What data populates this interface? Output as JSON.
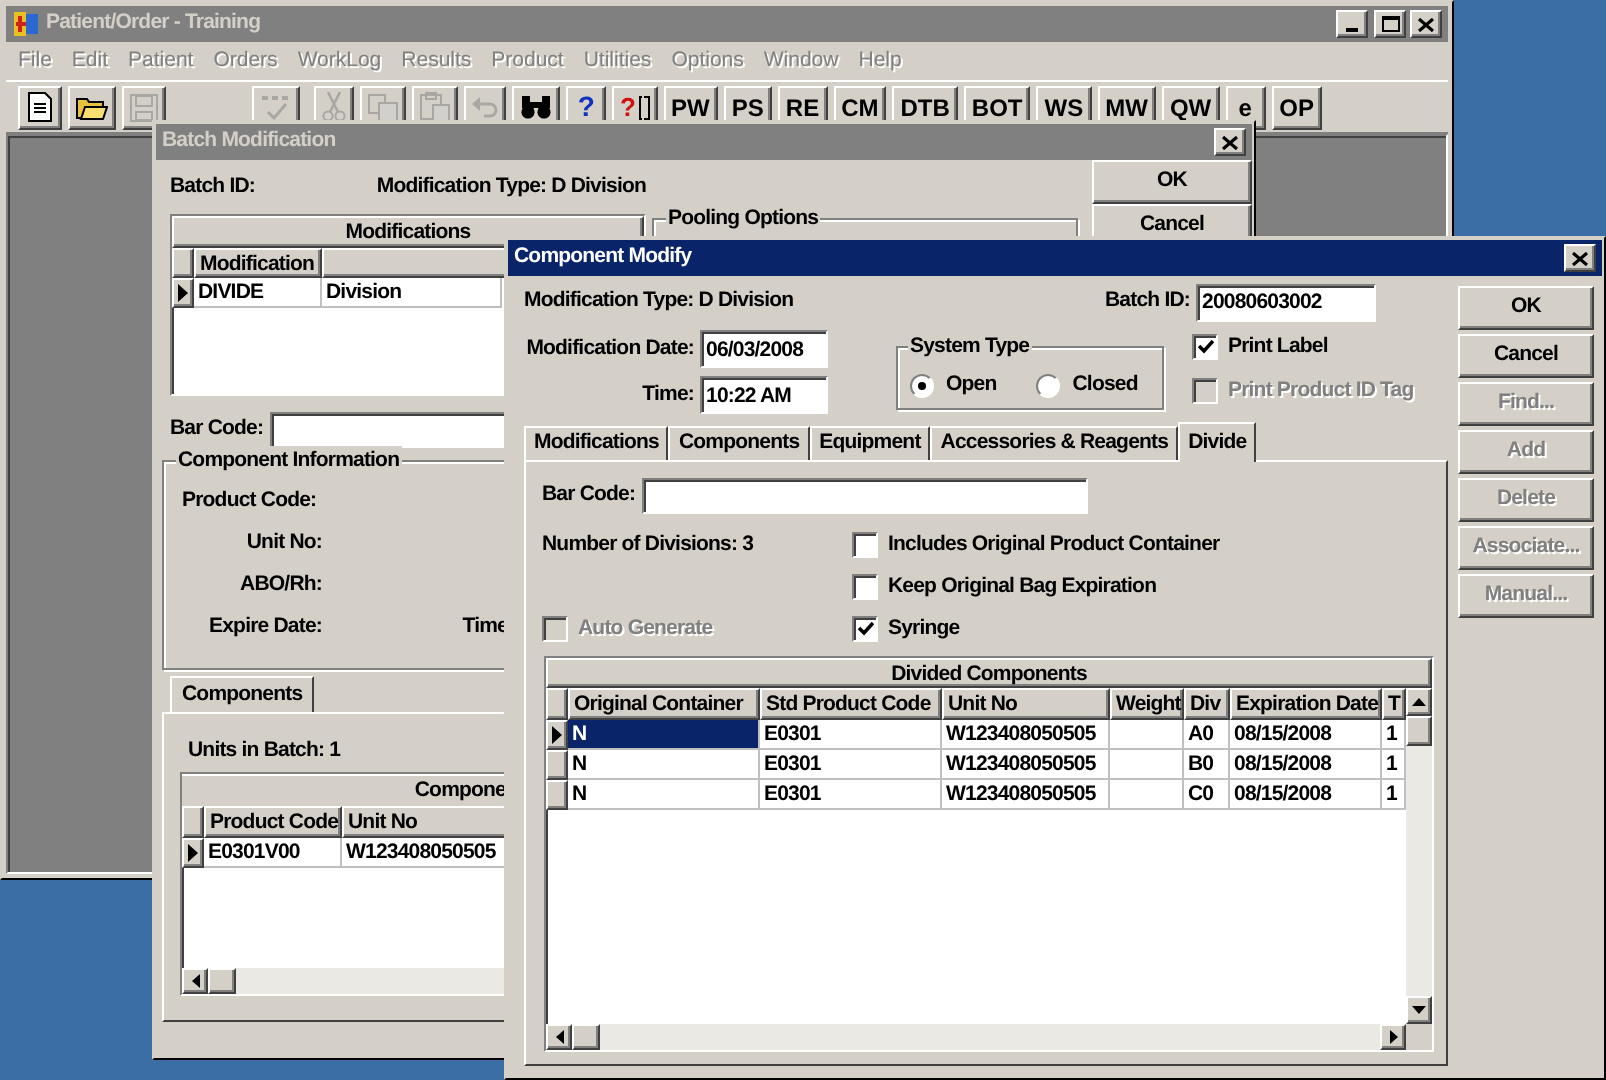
{
  "main_window": {
    "title": "Patient/Order - Training",
    "active": false,
    "menu": [
      {
        "label": "File",
        "disabled": true
      },
      {
        "label": "Edit",
        "disabled": true
      },
      {
        "label": "Patient",
        "disabled": true
      },
      {
        "label": "Orders",
        "disabled": true
      },
      {
        "label": "WorkLog",
        "disabled": true
      },
      {
        "label": "Results",
        "disabled": true
      },
      {
        "label": "Product",
        "disabled": true
      },
      {
        "label": "Utilities",
        "disabled": true
      },
      {
        "label": "Options",
        "disabled": true
      },
      {
        "label": "Window",
        "disabled": true
      },
      {
        "label": "Help",
        "disabled": true
      }
    ],
    "toolbar": [
      {
        "kind": "new",
        "disabled": false
      },
      {
        "kind": "open",
        "disabled": false
      },
      {
        "kind": "save",
        "disabled": true
      },
      {
        "kind": "spell",
        "disabled": true
      },
      {
        "kind": "cut",
        "disabled": true
      },
      {
        "kind": "copy",
        "disabled": true
      },
      {
        "kind": "paste",
        "disabled": true
      },
      {
        "kind": "undo",
        "disabled": true
      },
      {
        "kind": "find",
        "disabled": false
      },
      {
        "kind": "help",
        "label": "?"
      },
      {
        "kind": "context-help",
        "label": "?"
      },
      {
        "kind": "text",
        "label": "PW"
      },
      {
        "kind": "text",
        "label": "PS"
      },
      {
        "kind": "text",
        "label": "RE"
      },
      {
        "kind": "text",
        "label": "CM"
      },
      {
        "kind": "text",
        "label": "DTB"
      },
      {
        "kind": "text",
        "label": "BOT"
      },
      {
        "kind": "text",
        "label": "WS"
      },
      {
        "kind": "text",
        "label": "MW"
      },
      {
        "kind": "text",
        "label": "QW"
      },
      {
        "kind": "text",
        "label": "e"
      },
      {
        "kind": "text",
        "label": "OP"
      }
    ]
  },
  "batch_window": {
    "title": "Batch Modification",
    "active": false,
    "batch_id_label": "Batch ID:",
    "modification_type": "Modification Type: D  Division",
    "buttons": [
      {
        "label": "OK"
      },
      {
        "label": "Cancel"
      }
    ],
    "modifications": {
      "title": "Modifications",
      "columns": [
        "Modification"
      ],
      "rows": [
        {
          "cells": [
            "DIVIDE",
            "Division"
          ],
          "selected": true
        }
      ]
    },
    "pooling_options": "Pooling Options",
    "bar_code_label": "Bar Code:",
    "component_information": {
      "title": "Component Information",
      "fields": [
        "Product Code:",
        "Unit No:",
        "ABO/Rh:",
        "Expire Date:"
      ],
      "time_label": "Time"
    },
    "tabs": [
      {
        "label": "Components",
        "selected": true
      }
    ],
    "units_in_batch": "Units in Batch: 1",
    "components": {
      "title": "Compone",
      "columns": [
        "Product Code",
        "Unit No"
      ],
      "rows": [
        {
          "cells": [
            "E0301V00",
            "W123408050505"
          ],
          "selected": true
        }
      ]
    }
  },
  "component_window": {
    "title": "Component Modify",
    "active": true,
    "modification_type": "Modification Type: D  Division",
    "batch_id": {
      "label": "Batch ID:",
      "value": "20080603002"
    },
    "modification_date": {
      "label": "Modification Date:",
      "value": "06/03/2008"
    },
    "time": {
      "label": "Time:",
      "value": "10:22 AM"
    },
    "system_type": {
      "title": "System Type",
      "options": [
        {
          "label": "Open",
          "selected": true
        },
        {
          "label": "Closed",
          "selected": false
        }
      ]
    },
    "print_options": [
      {
        "label": "Print Label",
        "checked": true,
        "disabled": false
      },
      {
        "label": "Print Product ID Tag",
        "checked": false,
        "disabled": true
      }
    ],
    "buttons": [
      {
        "label": "OK",
        "disabled": false
      },
      {
        "label": "Cancel",
        "disabled": false
      },
      {
        "label": "Find...",
        "disabled": true
      },
      {
        "label": "Add",
        "disabled": true
      },
      {
        "label": "Delete",
        "disabled": true
      },
      {
        "label": "Associate...",
        "disabled": true
      },
      {
        "label": "Manual...",
        "disabled": true
      }
    ],
    "tabs": [
      {
        "label": "Modifications",
        "selected": false
      },
      {
        "label": "Components",
        "selected": false
      },
      {
        "label": "Equipment",
        "selected": false
      },
      {
        "label": "Accessories & Reagents",
        "selected": false
      },
      {
        "label": "Divide",
        "selected": true
      }
    ],
    "divide": {
      "bar_code_label": "Bar Code:",
      "number_of_divisions": "Number of Divisions:  3",
      "auto_generate": {
        "label": "Auto Generate",
        "checked": false,
        "disabled": true
      },
      "options": [
        {
          "label": "Includes Original Product Container",
          "checked": false,
          "disabled": false
        },
        {
          "label": "Keep Original Bag Expiration",
          "checked": false,
          "disabled": false
        },
        {
          "label": "Syringe",
          "checked": true,
          "disabled": false
        }
      ],
      "grid": {
        "title": "Divided Components",
        "columns": [
          "Original Container",
          "Std Product Code",
          "Unit No",
          "Weight",
          "Div",
          "Expiration Date",
          "T"
        ],
        "rows": [
          {
            "cells": [
              "N",
              "E0301",
              "W123408050505",
              null,
              "A0",
              "08/15/2008",
              "1"
            ],
            "selected": true
          },
          {
            "cells": [
              "N",
              "E0301",
              "W123408050505",
              null,
              "B0",
              "08/15/2008",
              "1"
            ],
            "selected": false
          },
          {
            "cells": [
              "N",
              "E0301",
              "W123408050505",
              null,
              "C0",
              "08/15/2008",
              "1"
            ],
            "selected": false
          }
        ]
      }
    }
  }
}
